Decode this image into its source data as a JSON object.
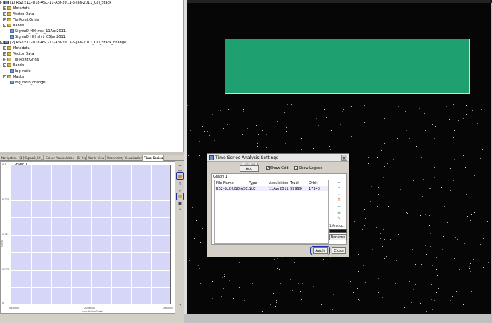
{
  "tree": {
    "product1": "[1] RS2-SLC-U18-ASC-11-Apr-2011-5-Jan-2011_Cal_Stack",
    "metadata1": "Metadata",
    "vector1": "Vector Data",
    "tiepoint1": "Tie-Point Grids",
    "bands1": "Bands",
    "band1a": "Sigma0_HH_mst_11Apr2011",
    "band1b": "Sigma0_HH_slv1_05Jan2011",
    "product2": "[2] RS2-SLC-U18-ASC-11-Apr-2011-5-Jan-2011_Cal_Stack_change",
    "metadata2": "Metadata",
    "vector2": "Vector Data",
    "tiepoint2": "Tie-Point Grids",
    "bands2": "Bands",
    "band2a": "log_ratio",
    "masks2": "Masks",
    "mask2a": "log_ratio_change"
  },
  "tabs": [
    "Navigation - [1] Sigma0_HH_mst_11Ap...",
    "Colour Manipulation - [1] Sigma0_HH...",
    "World View",
    "Uncertainty Visualisation",
    "Time Series"
  ],
  "graph": {
    "label": "Graph 1",
    "yticks": [
      "0.3",
      "0.225",
      "0.15",
      "0.075",
      "0"
    ],
    "xticks": [
      "05Jan00",
      "20Feb00",
      "15Mar00"
    ],
    "ylabel": "(units)",
    "xlabel": "Acquisition Date"
  },
  "dialog": {
    "title": "Time Series Analysis Settings",
    "add_graph": "Add Graph",
    "add_graph_tip": "Add a new graph",
    "show_grid": "Show Grid",
    "show_legend": "Show Legend",
    "graph_title": "Graph 1",
    "columns": [
      "File Name",
      "Type",
      "Acquisition",
      "Track",
      "Orbit"
    ],
    "row": {
      "file": "RS2-SLC-U18-ASC...",
      "type": "SLC",
      "acq": "11Apr2011",
      "track": "99999",
      "orbit": "17343"
    },
    "product_count": "1 Product",
    "rename": "Rename",
    "apply": "Apply",
    "close": "Close"
  },
  "colors": {
    "roi": "#1fa071",
    "plot_bg": "#d6d6f8",
    "highlight": "#1b2ea6"
  }
}
